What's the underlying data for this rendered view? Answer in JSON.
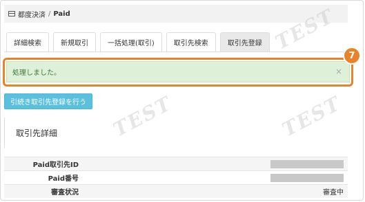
{
  "breadcrumb": {
    "parent": "都度決済",
    "separator": "/",
    "current": "Paid"
  },
  "tabs": [
    {
      "label": "詳細検索",
      "active": false
    },
    {
      "label": "新規取引",
      "active": false
    },
    {
      "label": "一括処理(取引)",
      "active": false
    },
    {
      "label": "取引先検索",
      "active": false
    },
    {
      "label": "取引先登録",
      "active": true
    }
  ],
  "alert": {
    "message": "処理しました。",
    "close": "×"
  },
  "step_badge": "7",
  "action_button": "引続き取引先登録を行う",
  "section_title": "取引先詳細",
  "details": [
    {
      "label": "Paid取引先ID",
      "value": ""
    },
    {
      "label": "Paid番号",
      "value": ""
    },
    {
      "label": "審査状況",
      "value": "審査中"
    }
  ],
  "watermark_text": "TEST",
  "colors": {
    "highlight": "#e8832a",
    "alert_bg": "#dff0d8",
    "alert_text": "#3c763d",
    "button": "#5bc0de"
  }
}
